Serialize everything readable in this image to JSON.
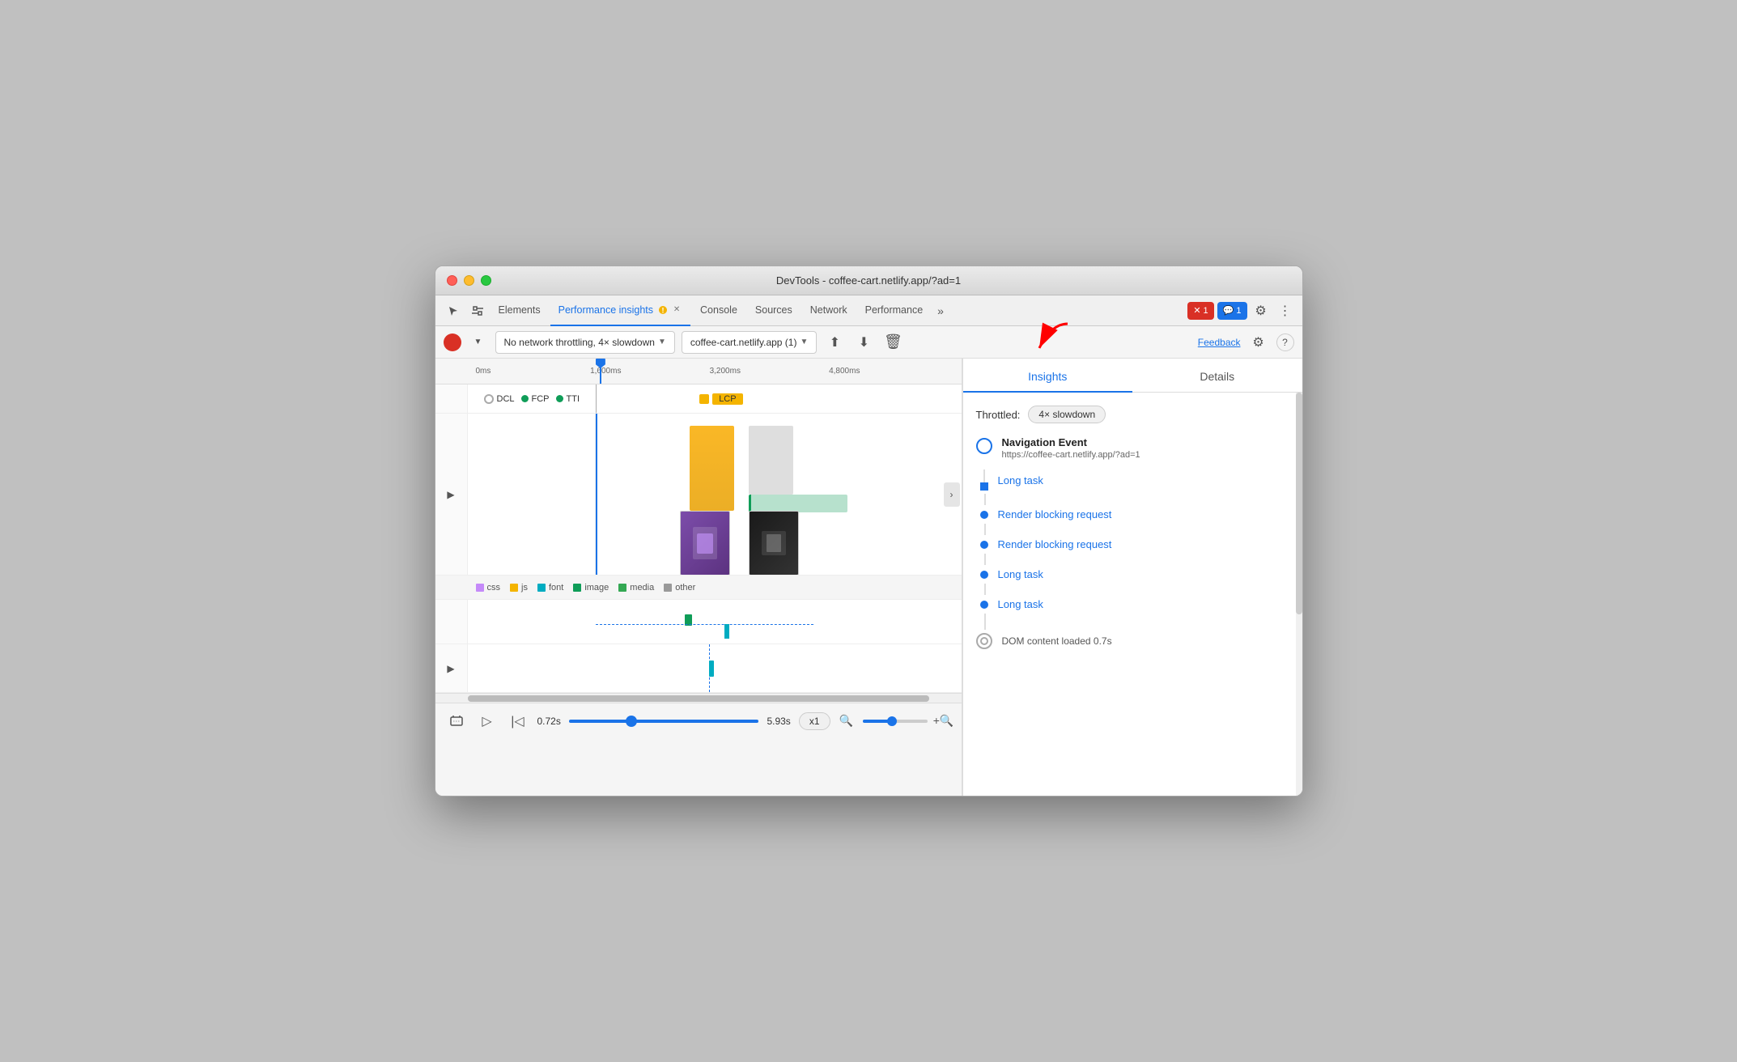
{
  "window": {
    "title": "DevTools - coffee-cart.netlify.app/?ad=1"
  },
  "tabs": {
    "items": [
      {
        "label": "Elements",
        "active": false
      },
      {
        "label": "Performance insights",
        "active": true
      },
      {
        "label": "Console",
        "active": false
      },
      {
        "label": "Sources",
        "active": false
      },
      {
        "label": "Network",
        "active": false
      },
      {
        "label": "Performance",
        "active": false
      }
    ],
    "more_icon": "⋮",
    "error_badge": "1",
    "message_badge": "1"
  },
  "toolbar": {
    "throttle_label": "No network throttling, 4× slowdown",
    "url_label": "coffee-cart.netlify.app (1)",
    "feedback_label": "Feedback"
  },
  "timeline": {
    "ruler": {
      "marks": [
        "0ms",
        "1,600ms",
        "3,200ms",
        "4,800ms"
      ]
    },
    "metrics": {
      "dcl_label": "DCL",
      "fcp_label": "FCP",
      "tti_label": "TTI",
      "lcp_label": "LCP"
    },
    "legend": {
      "items": [
        {
          "label": "css",
          "color": "#c58af9"
        },
        {
          "label": "js",
          "color": "#f4b400"
        },
        {
          "label": "font",
          "color": "#00acc1"
        },
        {
          "label": "image",
          "color": "#0f9d58"
        },
        {
          "label": "media",
          "color": "#34a853"
        },
        {
          "label": "other",
          "color": "#999"
        }
      ]
    }
  },
  "playback": {
    "start_time": "0.72s",
    "end_time": "5.93s",
    "speed": "x1"
  },
  "insights_panel": {
    "tab_insights": "Insights",
    "tab_details": "Details",
    "throttle_label": "Throttled:",
    "throttle_value": "4× slowdown",
    "nav_event_title": "Navigation Event",
    "nav_event_url": "https://coffee-cart.netlify.app/?ad=1",
    "items": [
      {
        "label": "Long task",
        "type": "link"
      },
      {
        "label": "Render blocking request",
        "type": "link"
      },
      {
        "label": "Render blocking request",
        "type": "link"
      },
      {
        "label": "Long task",
        "type": "link"
      },
      {
        "label": "Long task",
        "type": "link"
      }
    ],
    "dom_event": "DOM content loaded 0.7s"
  }
}
